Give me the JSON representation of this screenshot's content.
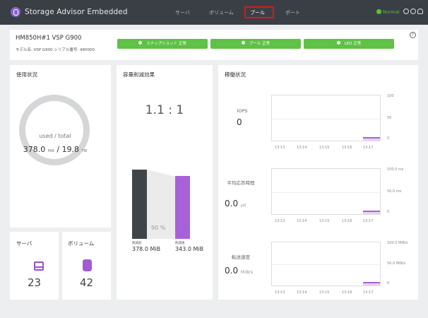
{
  "app": {
    "title": "Storage Advisor Embedded",
    "status": "Normal"
  },
  "nav": {
    "tabs": [
      {
        "label": "サーバ"
      },
      {
        "label": "ボリューム"
      },
      {
        "label": "プール"
      },
      {
        "label": "ポート"
      }
    ],
    "active_index": 2
  },
  "device": {
    "name": "HM850H#1 VSP G900",
    "model_line": "モデル名: VSP G900 シリアル番号: 490000"
  },
  "health": [
    {
      "label": "スナップショット 正常"
    },
    {
      "label": "プール 正常"
    },
    {
      "label": "LED 正常"
    }
  ],
  "usage": {
    "title": "使用状況",
    "label": "used / total",
    "used": "378.0",
    "used_unit": "MiB",
    "separator": "/",
    "total": "19.8",
    "total_unit": "TiB"
  },
  "reduction": {
    "title": "容量削減効果",
    "ratio": "1.1 : 1",
    "percent": "90 %",
    "before_caption": "削減前",
    "before_value": "378.0 MiB",
    "after_caption": "削減後",
    "after_value": "343.0 MiB"
  },
  "servers": {
    "title": "サーバ",
    "count": "23"
  },
  "volumes": {
    "title": "ボリューム",
    "count": "42"
  },
  "performance": {
    "title": "稼働状況",
    "iops": {
      "label": "IOPS",
      "value": "0",
      "yticks": [
        "100",
        "50",
        "0"
      ]
    },
    "latency": {
      "label": "平均応答時間",
      "value": "0.0",
      "unit": "μs",
      "yticks": [
        "100.0 ms",
        "50.0 ms",
        "0"
      ]
    },
    "throughput": {
      "label": "転送速度",
      "value": "0.0",
      "unit": "MiB/s",
      "yticks": [
        "100.0 MiB/s",
        "50.0 MiB/s",
        "0"
      ]
    },
    "xticks": [
      "13:13",
      "13:14",
      "13:15",
      "13:16",
      "13:17"
    ]
  }
}
